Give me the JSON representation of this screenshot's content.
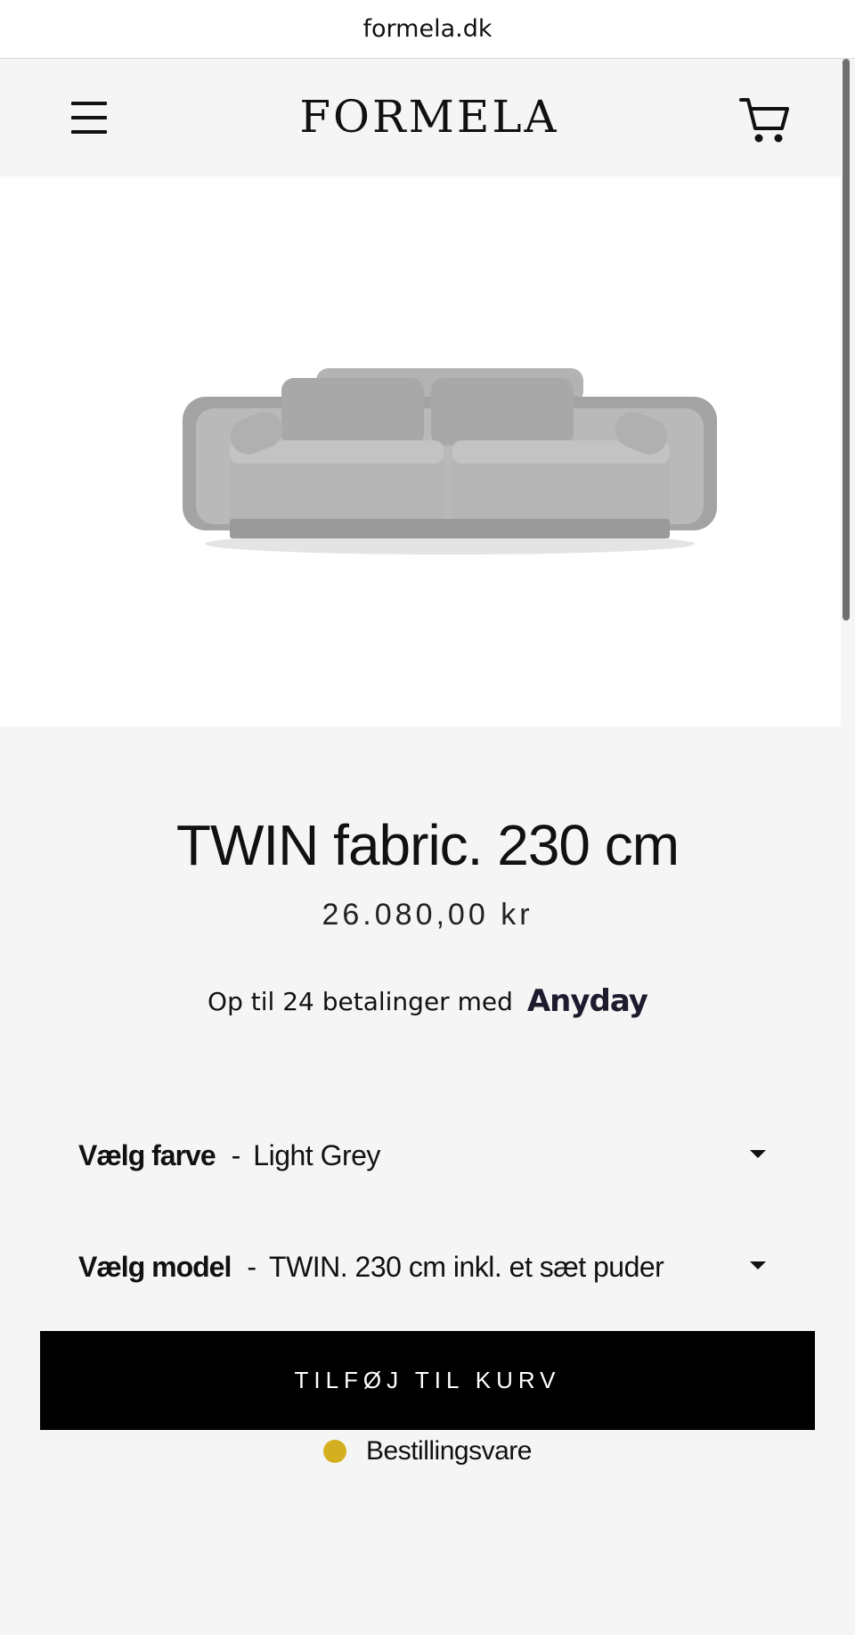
{
  "browser": {
    "url": "formela.dk"
  },
  "header": {
    "logo": "FORMELA",
    "menu_icon": "hamburger-menu-icon",
    "cart_icon": "shopping-cart-icon"
  },
  "product": {
    "title": "TWIN fabric. 230 cm",
    "price": "26.080,00 kr",
    "payment_text": "Op til 24 betalinger med",
    "payment_brand": "Anyday",
    "color_label": "Vælg farve",
    "color_value": "Light Grey",
    "model_label": "Vælg model",
    "model_value": "TWIN. 230 cm inkl. et sæt puder",
    "add_to_cart": "TILFØJ TIL KURV",
    "stock_status": "Bestillingsvare",
    "stock_color": "#d4b021"
  },
  "colors": {
    "page_bg": "#f5f5f5",
    "button_bg": "#000000",
    "sofa": "#a9a9a9"
  }
}
